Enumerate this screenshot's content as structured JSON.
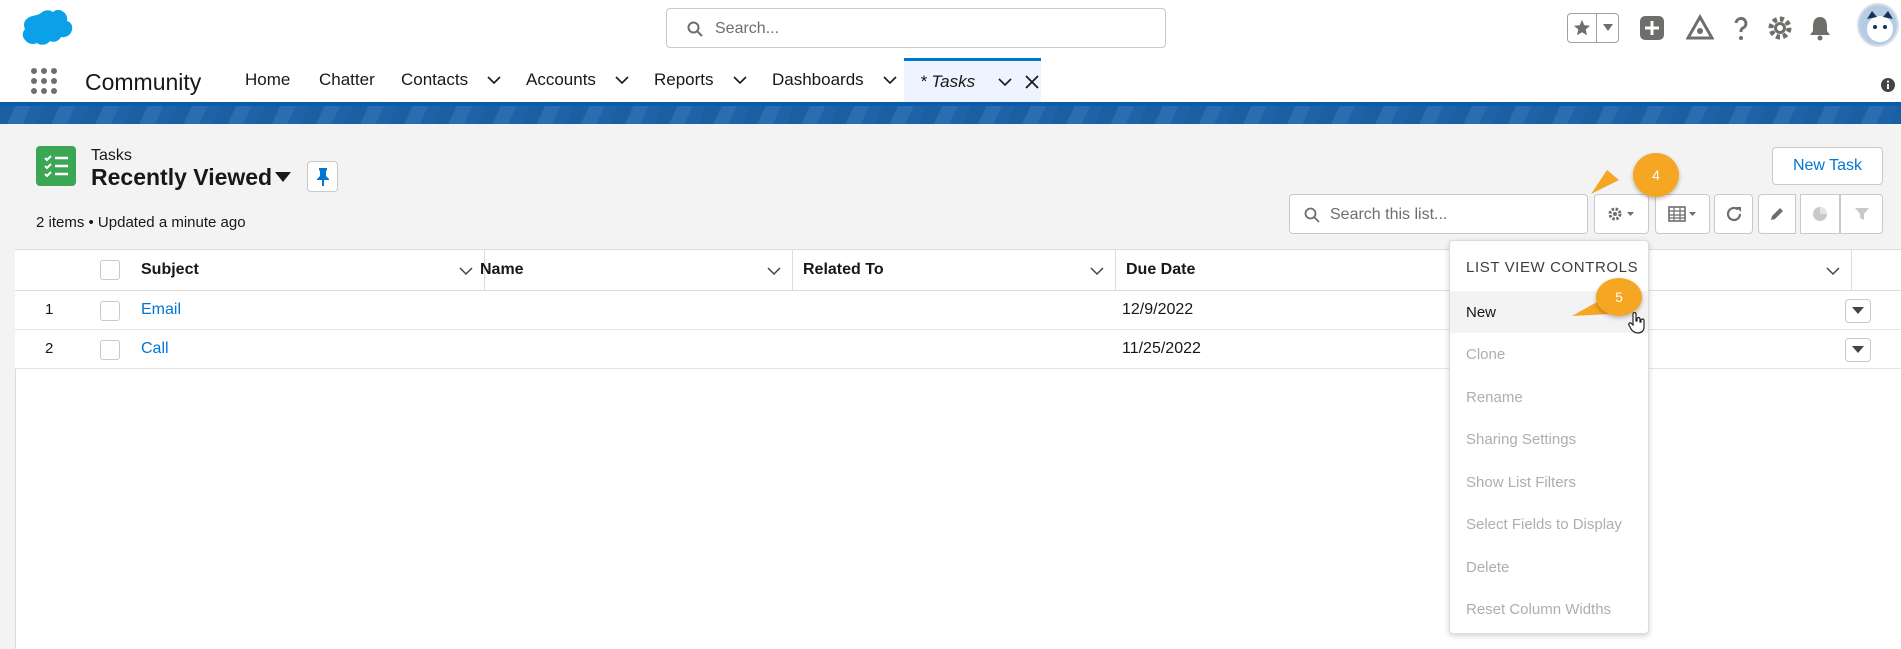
{
  "header": {
    "search_placeholder": "Search...",
    "icons": [
      "salesforce-cloud-icon",
      "favorites-star-icon",
      "global-add-icon",
      "trailhead-icon",
      "help-icon",
      "setup-gear-icon",
      "notifications-bell-icon",
      "avatar"
    ]
  },
  "nav": {
    "app_name": "Community",
    "tabs": [
      {
        "label": "Home"
      },
      {
        "label": "Chatter"
      },
      {
        "label": "Contacts"
      },
      {
        "label": "Accounts"
      },
      {
        "label": "Reports"
      },
      {
        "label": "Dashboards"
      },
      {
        "label": "* Tasks"
      }
    ]
  },
  "list": {
    "object_label": "Tasks",
    "view_name": "Recently Viewed",
    "meta": "2 items • Updated a minute ago",
    "new_button": "New Task",
    "search_placeholder": "Search this list...",
    "columns": [
      "Subject",
      "Name",
      "Related To",
      "Due Date"
    ],
    "rows": [
      {
        "num": "1",
        "subject": "Email",
        "due": "12/9/2022"
      },
      {
        "num": "2",
        "subject": "Call",
        "due": "11/25/2022"
      }
    ]
  },
  "menu": {
    "title": "LIST VIEW CONTROLS",
    "items": [
      "New",
      "Clone",
      "Rename",
      "Sharing Settings",
      "Show List Filters",
      "Select Fields to Display",
      "Delete",
      "Reset Column Widths"
    ]
  },
  "callouts": {
    "a": "4",
    "b": "5"
  },
  "colors": {
    "brand": "#0176d3",
    "task_icon": "#3ba755",
    "callout": "#f5a623"
  }
}
